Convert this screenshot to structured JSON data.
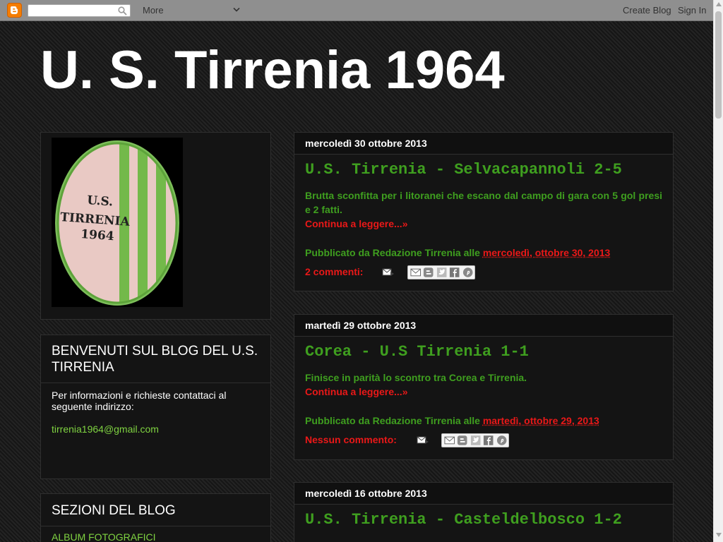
{
  "navbar": {
    "search_placeholder": "",
    "more_label": "More",
    "create_blog_label": "Create Blog",
    "sign_in_label": "Sign In"
  },
  "blog": {
    "title": "U. S. Tirrenia 1964"
  },
  "sidebar": {
    "welcome_title": "BENVENUTI SUL BLOG DEL U.S. TIRRENIA",
    "welcome_text": "Per informazioni e richieste contattaci al seguente indirizzo:",
    "welcome_email": "tirrenia1964@gmail.com",
    "sections_title": "SEZIONI DEL BLOG",
    "sections_items": [
      "ALBUM FOTOGRAFICI"
    ],
    "logo_text_lines": [
      "U.S.",
      "TIRRENIA",
      "1964"
    ]
  },
  "posts": [
    {
      "date_header": "mercoledì 30 ottobre 2013",
      "title": "U.S. Tirrenia - Selvacapannoli 2-5",
      "body": "Brutta sconfitta per i litoranei che escano dal campo di gara con 5 gol presi e 2 fatti.",
      "read_more": "Continua a leggere...»",
      "posted_by": "Pubblicato da Redazione Tirrenia alle ",
      "post_date": "mercoledì, ottobre 30, 2013",
      "comments": "2 commenti:"
    },
    {
      "date_header": "martedì 29 ottobre 2013",
      "title": "Corea - U.S Tirrenia 1-1",
      "body": "Finisce in parità lo scontro tra Corea e Tirrenia.",
      "read_more": "Continua a leggere...»",
      "posted_by": "Pubblicato da Redazione Tirrenia alle ",
      "post_date": "martedì, ottobre 29, 2013",
      "comments": "Nessun commento:"
    },
    {
      "date_header": "mercoledì 16 ottobre 2013",
      "title": "U.S. Tirrenia - Casteldelbosco 1-2"
    }
  ],
  "colors": {
    "accent_green": "#3f9f1f",
    "link_red": "#ea1818",
    "sidebar_link_green": "#7fd341",
    "navbar_gray": "#8f8f8f"
  },
  "icons": [
    "blogger-logo-icon",
    "search-icon",
    "chevron-down-icon",
    "email-post-icon",
    "share-email-icon",
    "blogthis-icon",
    "twitter-icon",
    "facebook-icon",
    "pinterest-icon"
  ]
}
